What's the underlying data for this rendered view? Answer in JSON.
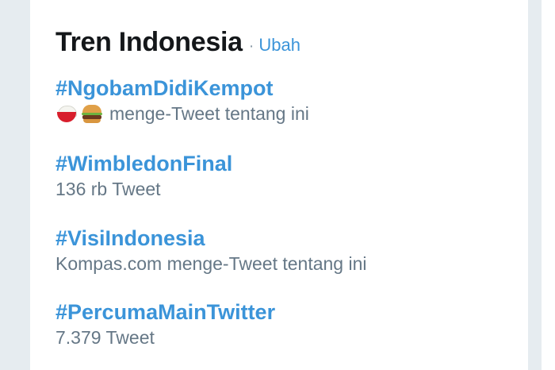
{
  "trends_panel": {
    "title": "Tren Indonesia",
    "separator": "·",
    "change_link": "Ubah",
    "items": [
      {
        "name": "#NgobamDidiKempot",
        "meta": "menge-Tweet tentang ini",
        "icons": [
          "rice-bowl-icon",
          "hamburger-icon"
        ]
      },
      {
        "name": "#WimbledonFinal",
        "meta": "136 rb Tweet"
      },
      {
        "name": "#VisiIndonesia",
        "meta": "Kompas.com menge-Tweet tentang ini"
      },
      {
        "name": "#PercumaMainTwitter",
        "meta": "7.379 Tweet"
      }
    ]
  },
  "colors": {
    "background": "#e6ecf0",
    "card": "#ffffff",
    "title": "#14171a",
    "link": "#3b94d9",
    "meta": "#657786"
  }
}
